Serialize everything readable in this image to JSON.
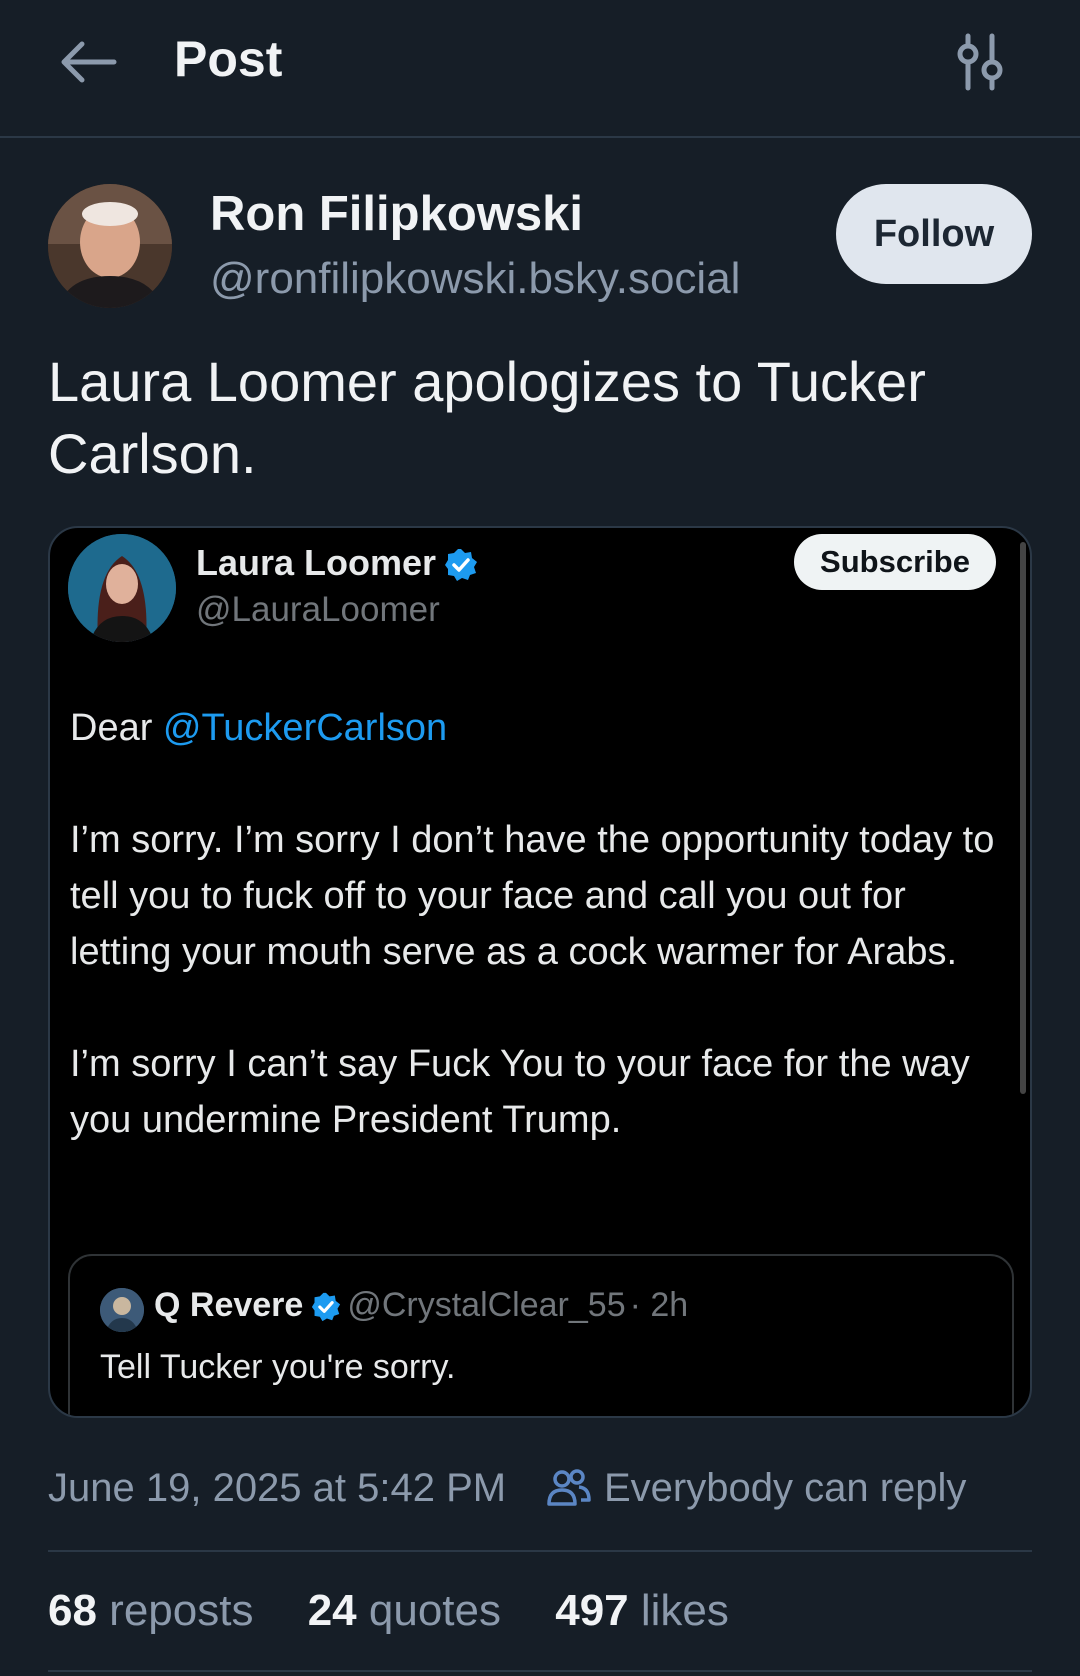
{
  "header": {
    "title": "Post",
    "back_icon": "arrow-left-icon",
    "settings_icon": "sliders-icon"
  },
  "author": {
    "name": "Ron Filipkowski",
    "handle": "@ronfilipkowski.bsky.social",
    "follow_label": "Follow"
  },
  "post": {
    "text": "Laura Loomer apologizes to Tucker Carlson."
  },
  "embed": {
    "name": "Laura Loomer",
    "handle": "@LauraLoomer",
    "subscribe_label": "Subscribe",
    "greeting_prefix": "Dear ",
    "mention": "@TuckerCarlson",
    "paragraph1": "I’m sorry. I’m sorry I don’t have the opportunity today to tell you to fuck off to your face and call you out for letting your mouth serve as a cock warmer for Arabs.",
    "paragraph2": "I’m sorry I can’t say Fuck You to your face for the way you undermine President Trump.",
    "quoted": {
      "name": "Q Revere",
      "handle": "@CrystalClear_55",
      "time": "· 2h",
      "text": "Tell Tucker you're sorry."
    }
  },
  "meta": {
    "date": "June 19, 2025 at 5:42 PM",
    "reply_setting": "Everybody can reply"
  },
  "stats": {
    "reposts_count": "68",
    "reposts_label": " reposts",
    "quotes_count": "24",
    "quotes_label": " quotes",
    "likes_count": "497",
    "likes_label": " likes"
  },
  "colors": {
    "background": "#161e27",
    "accent_link": "#1d9bf0",
    "muted_text": "#8c9aac"
  }
}
